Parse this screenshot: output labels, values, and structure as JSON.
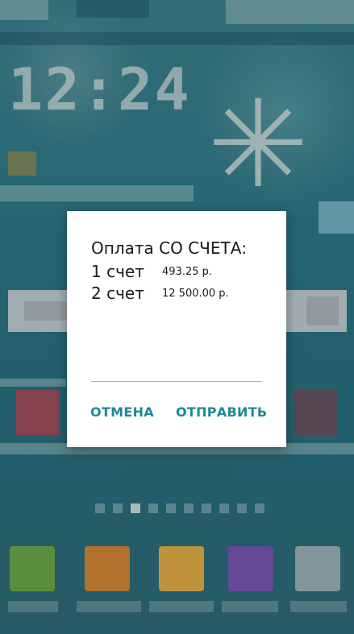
{
  "home": {
    "clock_time": "12:24",
    "weather_icon": "sun-icon"
  },
  "dialog": {
    "title": "Оплата СО СЧЕТА:",
    "accounts": [
      {
        "label": "1 счет",
        "amount": "493.25 р."
      },
      {
        "label": "2 счет",
        "amount": "12 500.00 р."
      }
    ],
    "cancel_label": "ОТМЕНА",
    "send_label": "ОТПРАВИТЬ",
    "accent_color": "#1c8996",
    "divider_color": "#86c6d0"
  },
  "dock": {
    "apps": [
      {
        "icon": "phone-app-icon",
        "color": "#6fae4a"
      },
      {
        "icon": "orange-app-icon",
        "color": "#d98a36"
      },
      {
        "icon": "notes-app-icon",
        "color": "#e8b44a"
      },
      {
        "icon": "purple-app-icon",
        "color": "#7c5ab8"
      },
      {
        "icon": "apps-drawer-icon",
        "color": "#9fb6ba"
      }
    ]
  }
}
